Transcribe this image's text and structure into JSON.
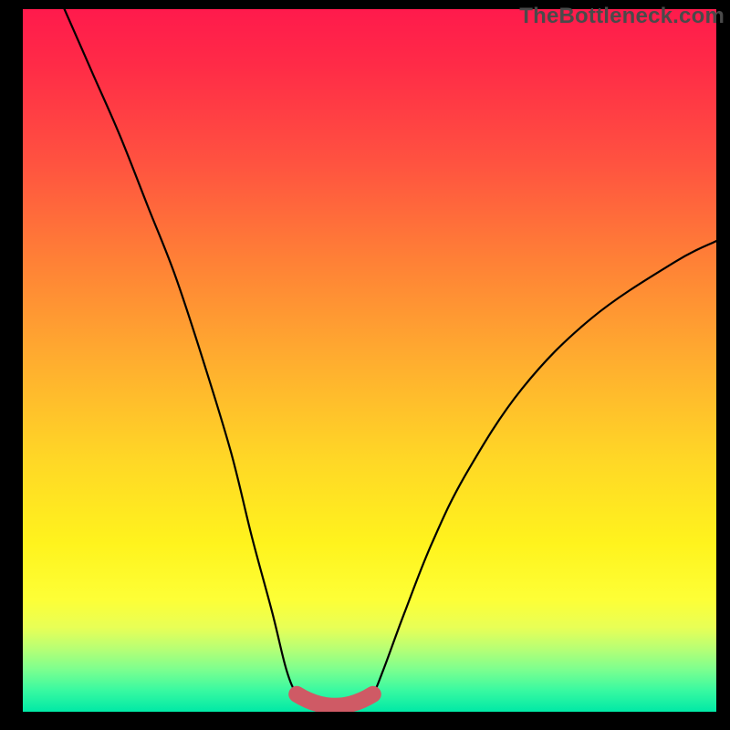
{
  "watermark": "TheBottleneck.com",
  "chart_data": {
    "type": "line",
    "title": "",
    "xlabel": "",
    "ylabel": "",
    "xlim": [
      0,
      100
    ],
    "ylim": [
      0,
      100
    ],
    "curve_points_pct": [
      [
        6,
        100
      ],
      [
        10,
        91
      ],
      [
        14,
        82
      ],
      [
        18,
        72
      ],
      [
        22,
        62
      ],
      [
        26,
        50
      ],
      [
        30,
        37
      ],
      [
        33,
        25
      ],
      [
        36,
        14
      ],
      [
        38,
        6
      ],
      [
        39.5,
        2.5
      ],
      [
        41,
        1.3
      ],
      [
        44,
        0.8
      ],
      [
        47,
        0.8
      ],
      [
        49,
        1.3
      ],
      [
        50.5,
        2.5
      ],
      [
        52,
        6
      ],
      [
        55,
        14
      ],
      [
        59,
        24
      ],
      [
        64,
        34
      ],
      [
        72,
        46
      ],
      [
        82,
        56
      ],
      [
        94,
        64
      ],
      [
        100,
        67
      ]
    ],
    "highlight_region_pct": {
      "start_x": 39.5,
      "end_x": 50.5,
      "min_y": 0.8,
      "rise": 2.5
    },
    "gradient_stops": [
      {
        "pct": 0,
        "color": "#ff1a4c"
      },
      {
        "pct": 22,
        "color": "#ff5340"
      },
      {
        "pct": 50,
        "color": "#ffad2f"
      },
      {
        "pct": 76,
        "color": "#fff31d"
      },
      {
        "pct": 91,
        "color": "#b8ff74"
      },
      {
        "pct": 100,
        "color": "#00e9a6"
      }
    ],
    "highlight_color": "#cf5a65",
    "line_color": "#000000"
  }
}
